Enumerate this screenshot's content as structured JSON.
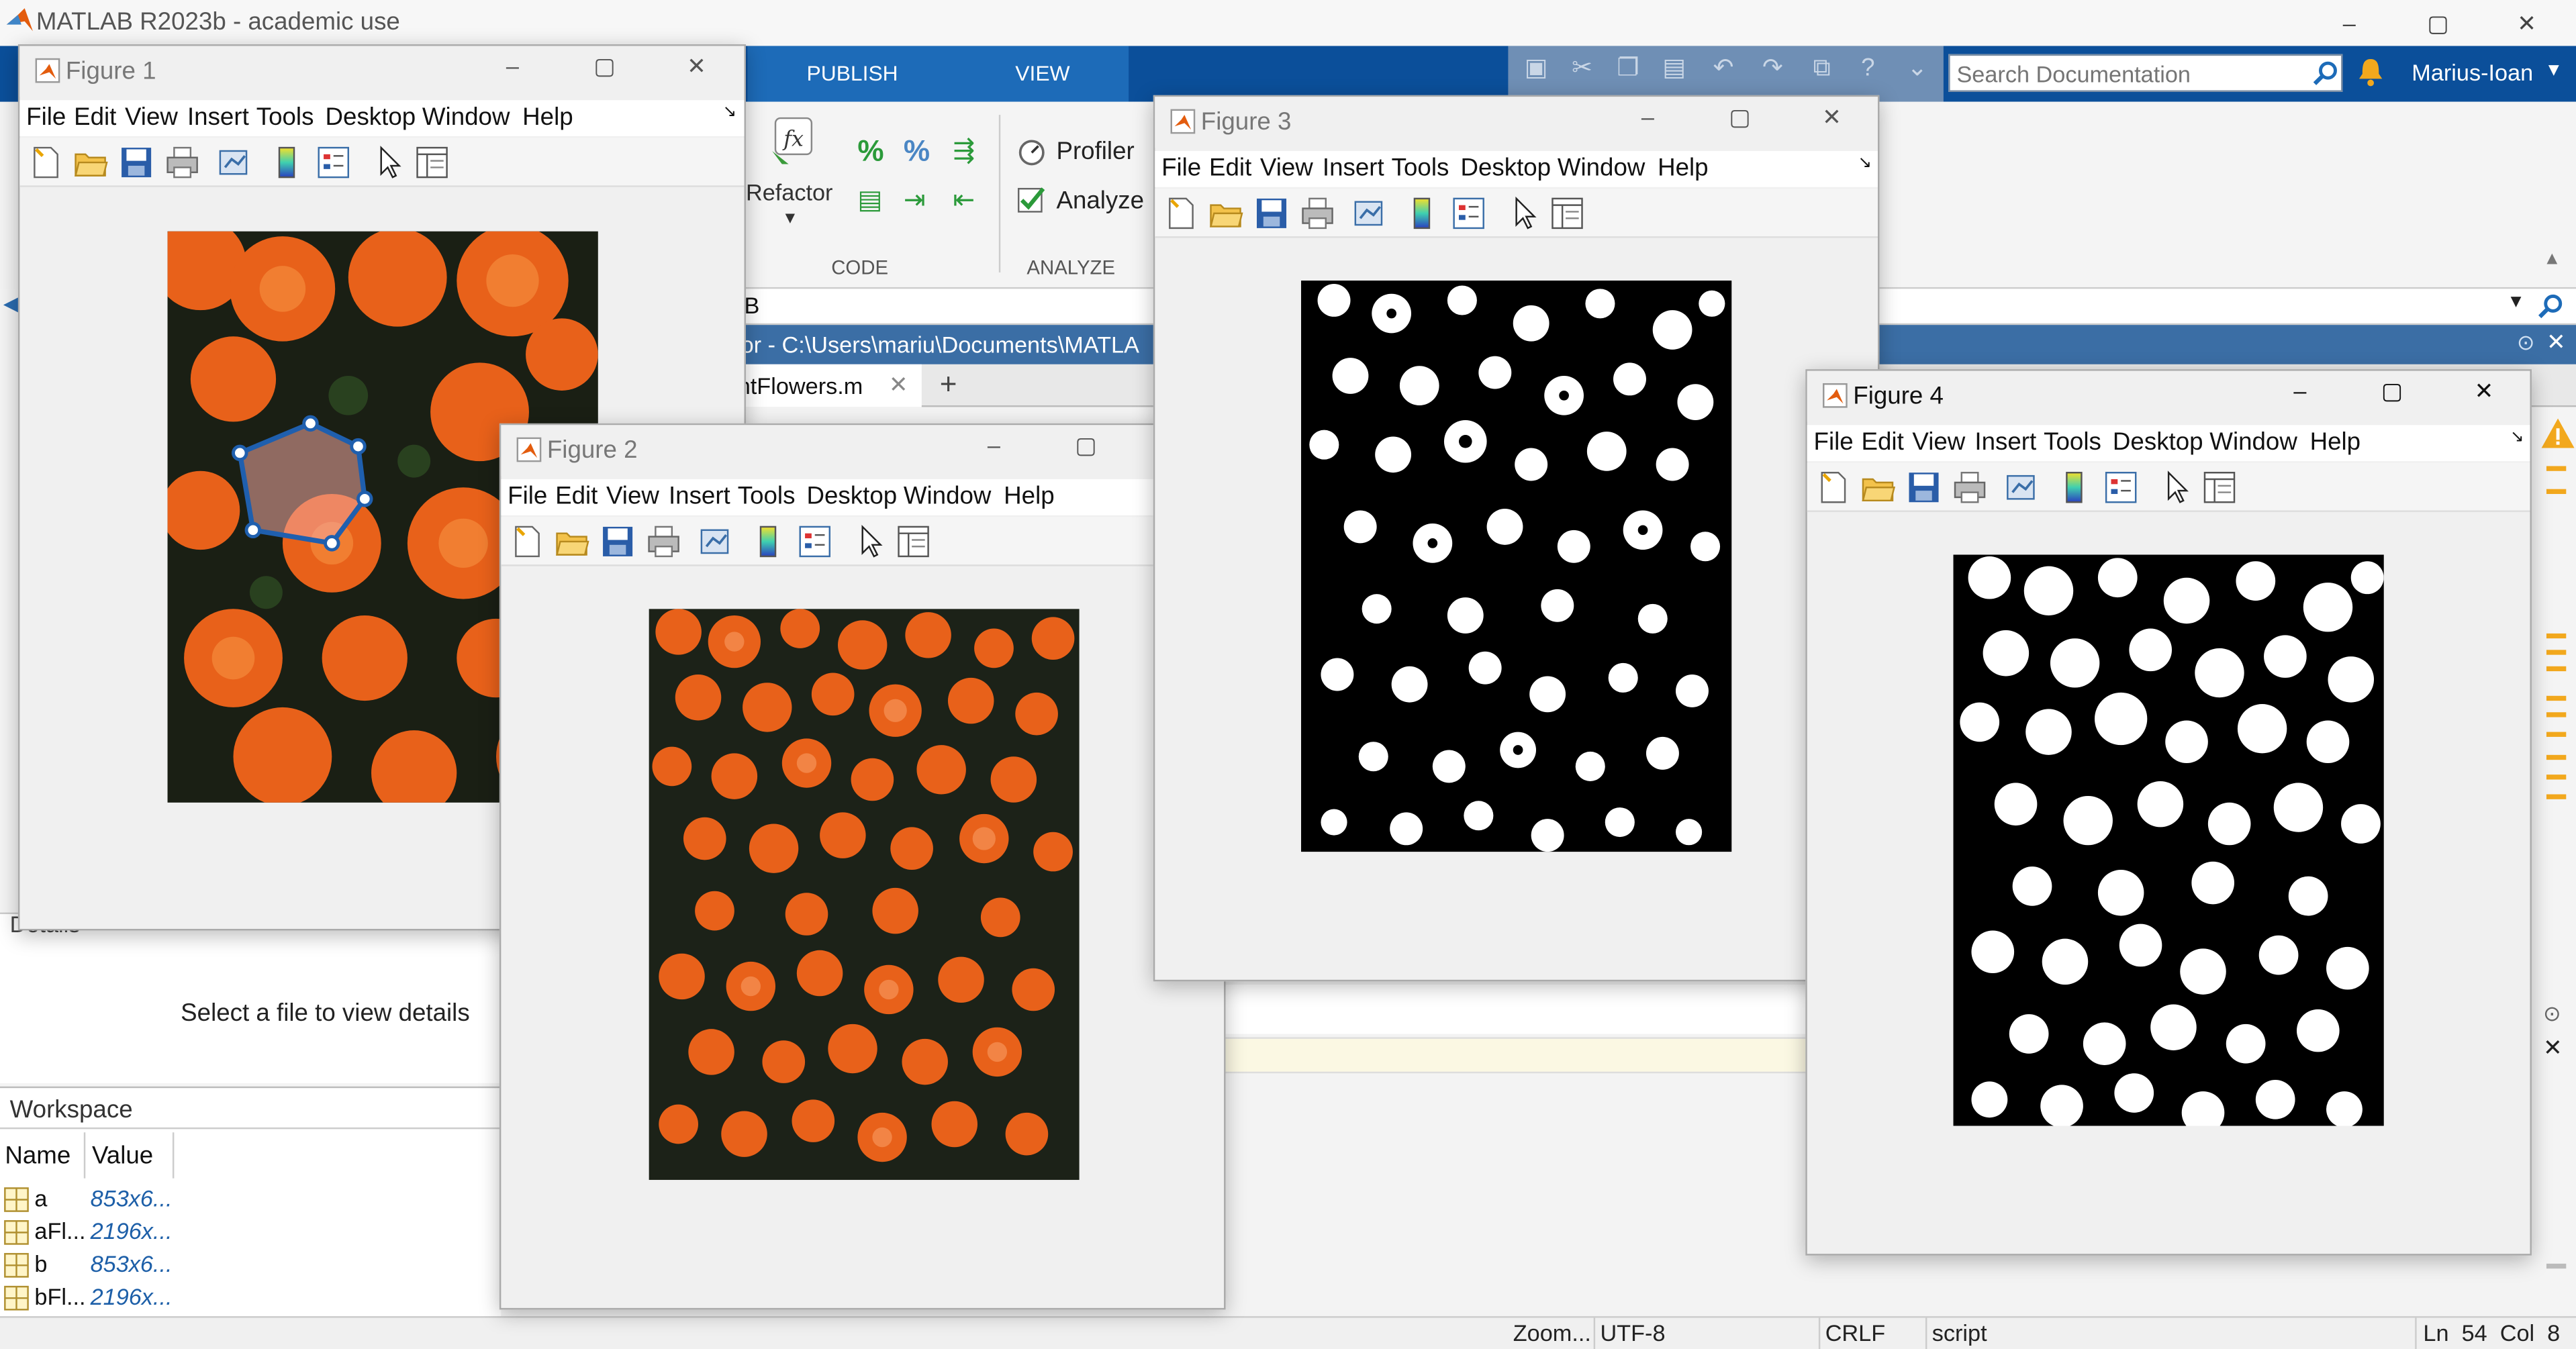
{
  "app": {
    "title": "MATLAB R2023b - academic use",
    "window_controls": {
      "minimize": "‒",
      "maximize": "▢",
      "close": "✕"
    }
  },
  "ribbon": {
    "tabs": [
      "PUBLISH",
      "VIEW"
    ],
    "refactor_label": "Refactor",
    "profiler_label": "Profiler",
    "analyze_label": "Analyze",
    "sections": [
      "CODE",
      "ANALYZE"
    ]
  },
  "toolbar": {
    "search_placeholder": "Search Documentation",
    "user": "Marius-Ioan"
  },
  "address": {
    "path_fragment": "B",
    "editor_title": "or - C:\\Users\\mariu\\Documents\\MATLA",
    "file_tab": "ntFlowers.m",
    "add_tab": "+"
  },
  "left": {
    "details_label": "Details",
    "details_message": "Select a file to view details",
    "workspace_title": "Workspace",
    "columns": [
      "Name",
      "Value"
    ],
    "rows": [
      {
        "name": "a",
        "value": "853x6..."
      },
      {
        "name": "aFl...",
        "value": "2196x..."
      },
      {
        "name": "b",
        "value": "853x6..."
      },
      {
        "name": "bFl...",
        "value": "2196x..."
      }
    ]
  },
  "figure_menu": [
    "File",
    "Edit",
    "View",
    "Insert",
    "Tools",
    "Desktop",
    "Window",
    "Help"
  ],
  "figures": [
    {
      "title": "Figure 1"
    },
    {
      "title": "Figure 2"
    },
    {
      "title": "Figure 3"
    },
    {
      "title": "Figure 4"
    }
  ],
  "status": {
    "zoom": "Zoom...",
    "encoding": "UTF-8",
    "eol": "CRLF",
    "type": "script",
    "position": "Ln  54  Col  8"
  },
  "colors": {
    "ribbon_dark": "#0b4f9a",
    "ribbon_active": "#1d6bb8",
    "flower_orange": "#f06a1e",
    "roi_blue": "#1f5fae"
  }
}
